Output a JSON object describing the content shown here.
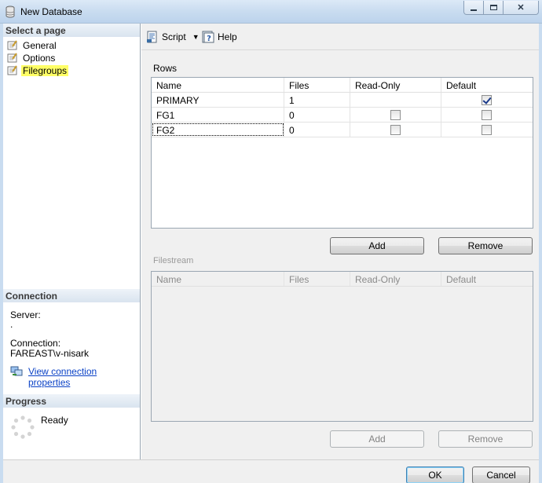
{
  "window": {
    "title": "New Database",
    "minimize": "▭",
    "maximize": "□",
    "close": "✕"
  },
  "sidebar": {
    "select_page_header": "Select a page",
    "pages": [
      {
        "label": "General",
        "selected": false
      },
      {
        "label": "Options",
        "selected": false
      },
      {
        "label": "Filegroups",
        "selected": true
      }
    ],
    "connection_header": "Connection",
    "server_label": "Server:",
    "server_value": ".",
    "connection_label": "Connection:",
    "connection_value": "FAREAST\\v-nisark",
    "view_connection_link": "View connection properties",
    "progress_header": "Progress",
    "progress_status": "Ready"
  },
  "toolbar": {
    "script_label": "Script",
    "help_label": "Help"
  },
  "rows_section": {
    "label": "Rows",
    "columns": [
      "Name",
      "Files",
      "Read-Only",
      "Default"
    ],
    "rows": [
      {
        "name": "PRIMARY",
        "files": "1",
        "read_only": null,
        "default": true
      },
      {
        "name": "FG1",
        "files": "0",
        "read_only": false,
        "default": false
      },
      {
        "name": "FG2",
        "files": "0",
        "read_only": false,
        "default": false
      }
    ],
    "add_label": "Add",
    "remove_label": "Remove"
  },
  "filestream_section": {
    "label": "Filestream",
    "columns": [
      "Name",
      "Files",
      "Read-Only",
      "Default"
    ],
    "add_label": "Add",
    "remove_label": "Remove"
  },
  "footer": {
    "ok_label": "OK",
    "cancel_label": "Cancel"
  }
}
